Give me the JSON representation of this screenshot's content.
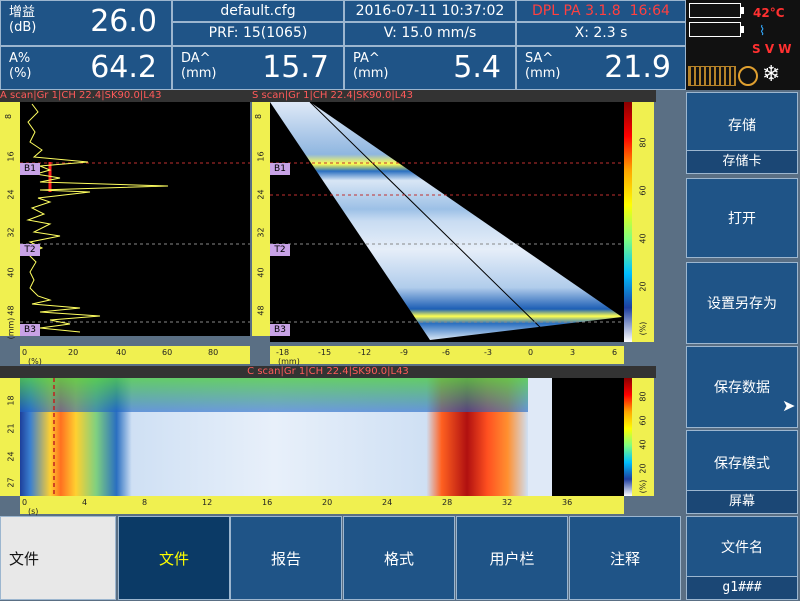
{
  "header": {
    "gain": {
      "label": "增益\n(dB)",
      "value": "26.0"
    },
    "amp": {
      "label": "A%\n(%)",
      "value": "64.2"
    },
    "file": "default.cfg",
    "prf": "PRF: 15(1065)",
    "datetime": "2016-07-11 10:37:02",
    "velocity": "V: 15.0 mm/s",
    "version": "DPL PA 3.1.8",
    "version_time": "16:64",
    "x_pos": "X: 2.3  s",
    "da": {
      "label": "DA^\n(mm)",
      "value": "15.7"
    },
    "pa": {
      "label": "PA^\n(mm)",
      "value": "5.4"
    },
    "sa": {
      "label": "SA^\n(mm)",
      "value": "21.9"
    },
    "temperature": "42°C",
    "svw": "S V W"
  },
  "ascan": {
    "title": "A scan|Gr 1|CH 22.4|SK90.0|L43",
    "y_ticks": [
      "8",
      "16",
      "24",
      "32",
      "40",
      "48"
    ],
    "x_ticks": [
      "0",
      "20",
      "40",
      "60",
      "80"
    ],
    "x_unit": "(%)",
    "y_unit": "(mm)",
    "markers": [
      "B1",
      "T2",
      "B3"
    ]
  },
  "sscan": {
    "title": "S scan|Gr 1|CH 22.4|SK90.0|L43",
    "y_ticks": [
      "8",
      "16",
      "24",
      "32",
      "40",
      "48"
    ],
    "x_ticks": [
      "-18",
      "-15",
      "-12",
      "-9",
      "-6",
      "-3",
      "0",
      "3",
      "6"
    ],
    "x_unit": "(mm)",
    "markers": [
      "B1",
      "T2",
      "B3"
    ],
    "scale_ticks": [
      "80",
      "60",
      "40",
      "20"
    ],
    "scale_unit": "(%)"
  },
  "cscan": {
    "title": "C scan|Gr 1|CH 22.4|SK90.0|L43",
    "y_ticks": [
      "18",
      "21",
      "24",
      "27"
    ],
    "x_ticks": [
      "0",
      "4",
      "8",
      "12",
      "16",
      "20",
      "24",
      "28",
      "32",
      "36"
    ],
    "x_unit": "(s)",
    "scale_ticks": [
      "80",
      "60",
      "40",
      "20"
    ],
    "scale_unit": "(%)"
  },
  "side": {
    "save": "存储",
    "save_sub": "存储卡",
    "open": "打开",
    "save_as": "设置另存为",
    "save_data": "保存数据",
    "save_mode": "保存模式",
    "save_mode_sub": "屏幕",
    "filename": "文件名",
    "filename_value": "g1###"
  },
  "tabs": [
    "文件",
    "报告",
    "格式",
    "用户栏",
    "注释"
  ],
  "left_tab": "文件",
  "colors": {
    "header_bg": "#1f5487",
    "active_tab": "#0b3a66",
    "accent_text": "#ffff00",
    "marker": "#c8a2e6",
    "scale_bg": "#f0f050"
  }
}
